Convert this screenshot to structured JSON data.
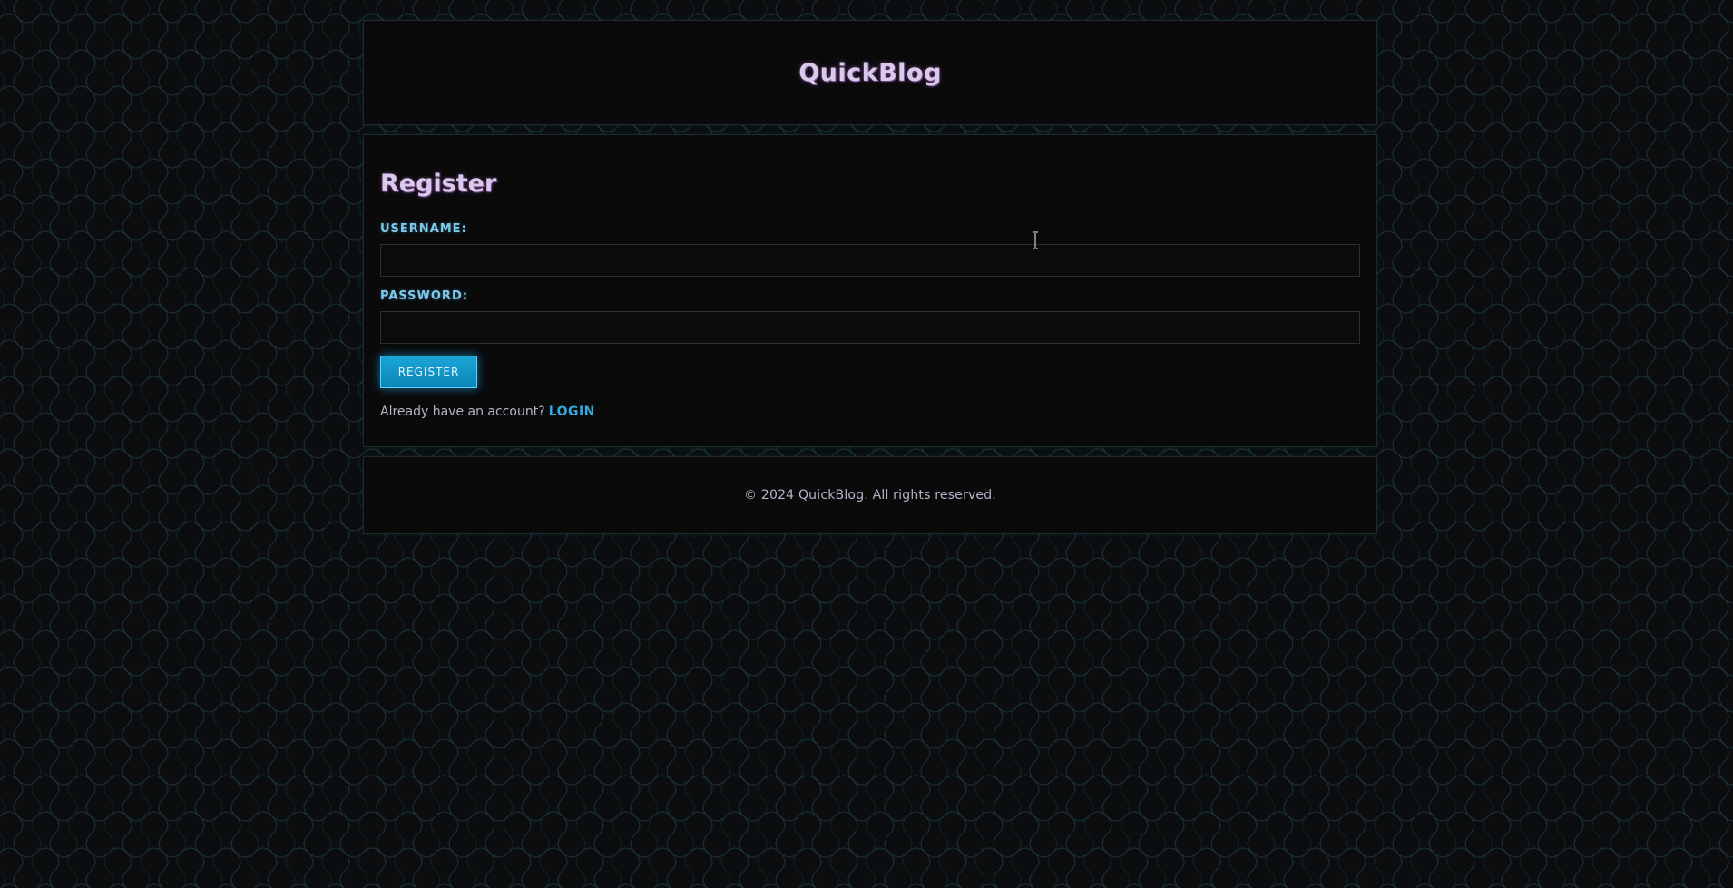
{
  "header": {
    "site_title": "QuickBlog"
  },
  "main": {
    "heading": "Register",
    "username_label": "USERNAME:",
    "username_value": "",
    "password_label": "PASSWORD:",
    "password_value": "",
    "register_button_label": "REGISTER",
    "login_prompt_text": "Already have an account?",
    "login_link_label": "LOGIN"
  },
  "footer": {
    "copyright": "© 2024 QuickBlog. All rights reserved."
  },
  "colors": {
    "background": "#0b0d0f",
    "panel": "#0a0a0b",
    "accent_cyan": "#33a8e0",
    "button": "#1aa6d8",
    "heading_text": "#d9c9ea",
    "label_text": "#7fc9e8",
    "pattern_stroke": "#1c3a3c"
  },
  "icons": {
    "cursor": "text-cursor-icon"
  }
}
